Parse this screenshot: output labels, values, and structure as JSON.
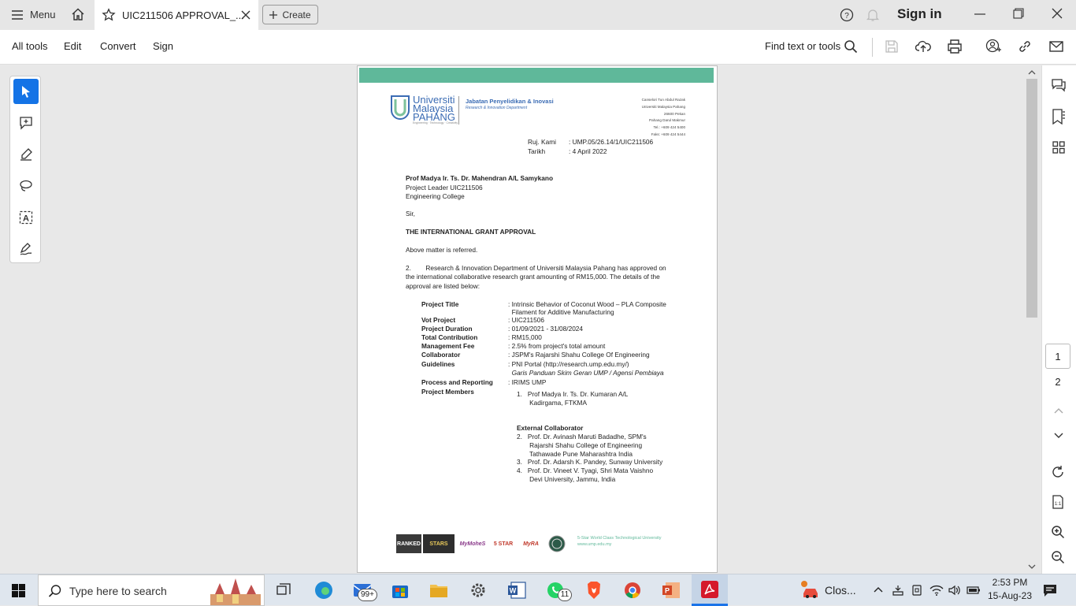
{
  "titlebar": {
    "menu_label": "Menu",
    "tab_title": "UIC211506 APPROVAL_...",
    "create_label": "Create",
    "sign_in_label": "Sign in"
  },
  "toolbar": {
    "all_tools": "All tools",
    "edit": "Edit",
    "convert": "Convert",
    "sign": "Sign",
    "find_label": "Find text or tools"
  },
  "document": {
    "university_name_1": "Universiti",
    "university_name_2": "Malaysia",
    "university_name_3": "PAHANG",
    "university_tagline": "Engineering · Technology · Creativity",
    "department": "Jabatan Penyelidikan & Inovasi",
    "department_en": "Research & Innovation Department",
    "address_lines": [
      "Canselori Tun Abdul Razak",
      "Universiti Malaysia Pahang",
      "26600 Pekan",
      "Pahang Darul Makmur",
      "Tel.: +609 424 5400",
      "Faks: +609 424 5444"
    ],
    "ruj_label": "Ruj. Kami",
    "ruj_value": ": UMP.05/26.14/1/UIC211506",
    "tarikh_label": "Tarikh",
    "tarikh_value": ": 4 April 2022",
    "recipient_name": "Prof Madya Ir. Ts. Dr. Mahendran A/L Samykano",
    "recipient_line2": "Project Leader UIC211506",
    "recipient_line3": "Engineering College",
    "salutation": "Sir,",
    "subject": "THE INTERNATIONAL GRANT APPROVAL",
    "para1": "Above matter is referred.",
    "para2_line1": "2.        Research & Innovation Department of Universiti Malaysia Pahang has approved on",
    "para2_line2": "the international collaborative research grant amounting of RM15,000. The details of the",
    "para2_line3": "approval are listed below:",
    "details": [
      {
        "label": "Project Title",
        "value": ": Intrinsic Behavior of Coconut Wood – PLA Composite"
      },
      {
        "label": "",
        "value": "  Filament for Additive Manufacturing"
      },
      {
        "label": "Vot Project",
        "value": ": UIC211506"
      },
      {
        "label": "Project Duration",
        "value": ": 01/09/2021 - 31/08/2024"
      },
      {
        "label": "Total Contribution",
        "value": ": RM15,000"
      },
      {
        "label": "Management Fee",
        "value": ": 2.5% from project's total amount"
      },
      {
        "label": "Collaborator",
        "value": ": JSPM's Rajarshi Shahu College Of Engineering"
      },
      {
        "label": "Guidelines",
        "value": ": PNI Portal (http://research.ump.edu.my/)"
      },
      {
        "label": "",
        "value": "  Garis Panduan Skim Geran UMP / Agensi Pembiaya"
      },
      {
        "label": "Process and Reporting",
        "value": ": IRIMS UMP"
      },
      {
        "label": "Project Members",
        "value": ""
      }
    ],
    "members": [
      "1.   Prof Madya Ir. Ts. Dr. Kumaran A/L",
      "       Kadirgama, FTKMA"
    ],
    "external_heading": "External Collaborator",
    "external": [
      "2.   Prof. Dr. Avinash Maruti Badadhe, SPM's",
      "       Rajarshi Shahu College of Engineering",
      "       Tathawade Pune Maharashtra India",
      "3.   Prof. Dr. Adarsh K. Pandey, Sunway University",
      "4.   Prof. Dr. Vineet V. Tyagi, Shri Mata Vaishno",
      "       Devi University, Jammu, India"
    ],
    "footer_slogan": "5-Star World Class Technological University",
    "footer_url": "www.ump.edu.my",
    "footer_badges": [
      "RANKED",
      "STARS",
      "MyMoheS",
      "5 STAR",
      "MyRA"
    ]
  },
  "pages": {
    "page1": "1",
    "page2": "2"
  },
  "taskbar": {
    "search_placeholder": "Type here to search",
    "mail_badge": "99+",
    "whatsapp_badge": "11",
    "notification_label": "Clos...",
    "time": "2:53 PM",
    "date": "15-Aug-23"
  },
  "colors": {
    "accent": "#1a73e8",
    "active_tool": "#1473e6",
    "banner": "#5fb89a"
  }
}
